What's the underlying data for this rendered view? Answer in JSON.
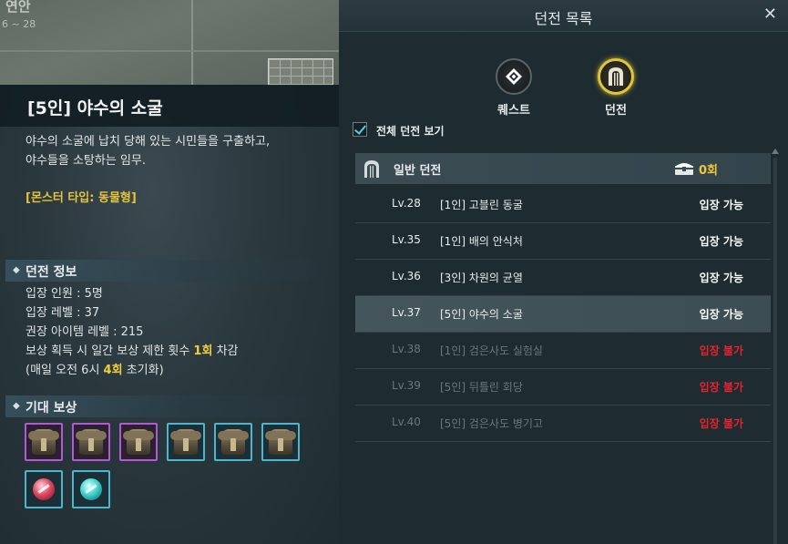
{
  "map": {
    "region_name": "연안",
    "region_level": "6 ~ 28"
  },
  "dungeon_detail": {
    "title": "[5인] 야수의 소굴",
    "description_line1": "야수의 소굴에 납치 당해 있는 시민들을 구출하고,",
    "description_line2": "야수들을 소탕하는 임무.",
    "monster_type": "[몬스터 타입: 동물형]",
    "info_header": "던전 정보",
    "info": {
      "party_size": "입장 인원 : 5명",
      "entry_level": "입장 레벨 : 37",
      "recommended_item_level": "권장 아이템 레벨 : 215",
      "reward_limit_prefix": "보상 획득 시 일간 보상 제한 횟수 ",
      "reward_limit_value": "1회",
      "reward_limit_suffix": " 차감",
      "reset_prefix": "(매일 오전 6시 ",
      "reset_value": "4회",
      "reset_suffix": " 초기화)"
    },
    "reward_header": "기대 보상",
    "rewards": [
      {
        "icon": "chest-armor-icon",
        "grade_color": "#b15ad3"
      },
      {
        "icon": "chest-armor-icon",
        "grade_color": "#b15ad3"
      },
      {
        "icon": "chest-armor-icon",
        "grade_color": "#b15ad3"
      },
      {
        "icon": "chest-armor-icon",
        "grade_color": "#4ab7cc"
      },
      {
        "icon": "chest-armor-icon",
        "grade_color": "#4ab7cc"
      },
      {
        "icon": "chest-armor-icon",
        "grade_color": "#4ab7cc"
      },
      {
        "icon": "red-gem-icon",
        "grade_color": "#4ab7cc"
      },
      {
        "icon": "cyan-gem-icon",
        "grade_color": "#4ab7cc"
      }
    ]
  },
  "dungeon_list": {
    "title": "던전 목록",
    "tabs": {
      "quest": "퀘스트",
      "dungeon": "던전",
      "active": "dungeon"
    },
    "show_all_label": "전체 던전 보기",
    "show_all_checked": true,
    "category": {
      "label": "일반 던전",
      "count": "0회"
    },
    "rows": [
      {
        "level": "Lv.28",
        "name": "[1인] 고블린 동굴",
        "status": "입장 가능",
        "available": true
      },
      {
        "level": "Lv.35",
        "name": "[1인] 배의 안식처",
        "status": "입장 가능",
        "available": true
      },
      {
        "level": "Lv.36",
        "name": "[3인] 차원의 균열",
        "status": "입장 가능",
        "available": true
      },
      {
        "level": "Lv.37",
        "name": "[5인] 야수의 소굴",
        "status": "입장 가능",
        "available": true,
        "selected": true
      },
      {
        "level": "Lv.38",
        "name": "[1인] 검은사도 실험실",
        "status": "입장 불가",
        "available": false
      },
      {
        "level": "Lv.39",
        "name": "[5인] 뒤틀린 회당",
        "status": "입장 불가",
        "available": false
      },
      {
        "level": "Lv.40",
        "name": "[5인] 검은사도 병기고",
        "status": "입장 불가",
        "available": false
      }
    ],
    "colors": {
      "available": "#ffffff",
      "unavailable": "#e8232e",
      "highlight": "#f0c83a"
    }
  }
}
